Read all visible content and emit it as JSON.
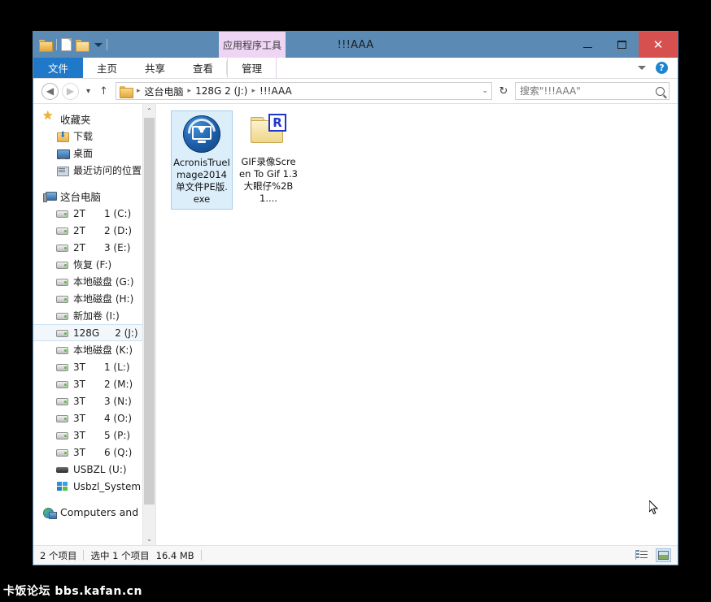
{
  "window": {
    "title": "!!!AAA",
    "contextual_tab": "应用程序工具",
    "min_label": "最小化",
    "max_label": "最大化",
    "close_label": "✕"
  },
  "ribbon": {
    "tabs": [
      {
        "label": "文件",
        "active": true
      },
      {
        "label": "主页",
        "active": false
      },
      {
        "label": "共享",
        "active": false
      },
      {
        "label": "查看",
        "active": false
      },
      {
        "label": "管理",
        "active": false
      }
    ],
    "minimize_ribbon_icon": "chevron-down-icon",
    "help_label": "?"
  },
  "address": {
    "back_glyph": "◀",
    "forward_glyph": "▶",
    "history_glyph": "▾",
    "up_glyph": "↑",
    "breadcrumb": [
      "这台电脑",
      "128G      2 (J:)",
      "!!!AAA"
    ],
    "dropdown_glyph": "⌄",
    "refresh_glyph": "↻"
  },
  "search": {
    "placeholder": "搜索\"!!!AAA\"",
    "value": ""
  },
  "sidebar": {
    "groups": [
      {
        "name": "favorites",
        "header": {
          "label": "收藏夹",
          "icon": "star-icon"
        },
        "items": [
          {
            "label": "下载",
            "icon": "download-folder-icon"
          },
          {
            "label": "桌面",
            "icon": "desktop-icon"
          },
          {
            "label": "最近访问的位置",
            "icon": "recent-places-icon"
          }
        ]
      },
      {
        "name": "this-pc",
        "header": {
          "label": "这台电脑",
          "icon": "computer-icon"
        },
        "items": [
          {
            "label": "2T",
            "suffix": "1 (C:)",
            "icon": "drive-icon"
          },
          {
            "label": "2T",
            "suffix": "2 (D:)",
            "icon": "drive-icon"
          },
          {
            "label": "2T",
            "suffix": "3 (E:)",
            "icon": "drive-icon"
          },
          {
            "label": "恢复 (F:)",
            "suffix": "",
            "icon": "drive-icon"
          },
          {
            "label": "本地磁盘 (G:)",
            "suffix": "",
            "icon": "drive-icon"
          },
          {
            "label": "本地磁盘 (H:)",
            "suffix": "",
            "icon": "drive-icon"
          },
          {
            "label": "新加卷 (I:)",
            "suffix": "",
            "icon": "drive-icon"
          },
          {
            "label": "128G",
            "suffix": "2 (J:)",
            "icon": "drive-icon",
            "selected": true
          },
          {
            "label": "本地磁盘 (K:)",
            "suffix": "",
            "icon": "drive-icon"
          },
          {
            "label": "3T",
            "suffix": "1 (L:)",
            "icon": "drive-icon"
          },
          {
            "label": "3T",
            "suffix": "2 (M:)",
            "icon": "drive-icon"
          },
          {
            "label": "3T",
            "suffix": "3 (N:)",
            "icon": "drive-icon"
          },
          {
            "label": "3T",
            "suffix": "4 (O:)",
            "icon": "drive-icon"
          },
          {
            "label": "3T",
            "suffix": "5 (P:)",
            "icon": "drive-icon"
          },
          {
            "label": "3T",
            "suffix": "6 (Q:)",
            "icon": "drive-icon"
          },
          {
            "label": "USBZL (U:)",
            "suffix": "",
            "icon": "usb-drive-icon"
          },
          {
            "label": "Usbzl_System (X",
            "suffix": "",
            "icon": "windows-drive-icon"
          }
        ]
      },
      {
        "name": "network",
        "header": {
          "label": "Computers and D",
          "icon": "network-icon"
        },
        "items": []
      }
    ],
    "scroll_up_glyph": "⌃",
    "scroll_down_glyph": "⌄"
  },
  "files": [
    {
      "name": "AcronisTrueImage2014单文件PE版.exe",
      "icon": "acronis-true-image-icon",
      "selected": true
    },
    {
      "name": "GIF录像Screen To Gif 1.3大眼仔%2B1....",
      "icon": "folder-with-r-badge-icon",
      "selected": false
    }
  ],
  "status": {
    "item_count": "2 个项目",
    "selection": "选中 1 个项目",
    "size": "16.4 MB",
    "details_view_icon": "details-view-icon",
    "tiles_view_icon": "large-icons-view-icon"
  },
  "watermark": "卡饭论坛 bbs.kafan.cn",
  "colors": {
    "titlebar": "#5b8bb5",
    "file_tab": "#2079c8",
    "contextual_tab": "#efd5f4",
    "close_button": "#d75050",
    "selection": "#ddeefb"
  }
}
